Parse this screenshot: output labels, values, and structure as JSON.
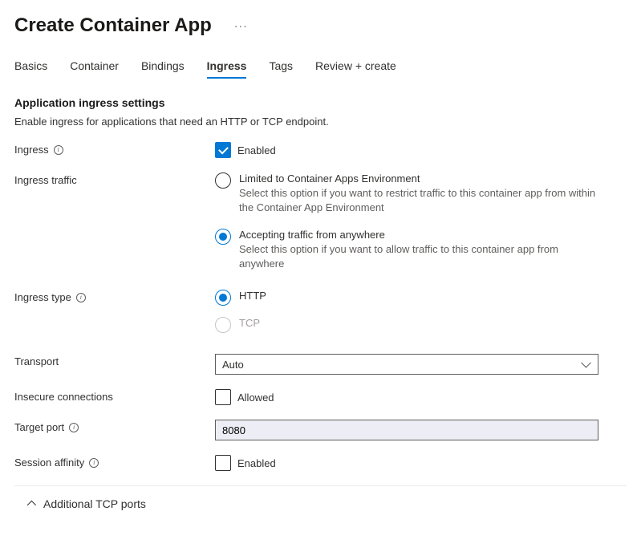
{
  "header": {
    "title": "Create Container App",
    "ellipsis": "···"
  },
  "tabs": [
    {
      "label": "Basics",
      "active": false
    },
    {
      "label": "Container",
      "active": false
    },
    {
      "label": "Bindings",
      "active": false
    },
    {
      "label": "Ingress",
      "active": true
    },
    {
      "label": "Tags",
      "active": false
    },
    {
      "label": "Review + create",
      "active": false
    }
  ],
  "section": {
    "title": "Application ingress settings",
    "desc": "Enable ingress for applications that need an HTTP or TCP endpoint."
  },
  "fields": {
    "ingress": {
      "label": "Ingress",
      "value_label": "Enabled",
      "checked": true
    },
    "traffic": {
      "label": "Ingress traffic",
      "options": [
        {
          "label": "Limited to Container Apps Environment",
          "desc": "Select this option if you want to restrict traffic to this container app from within the Container App Environment",
          "checked": false
        },
        {
          "label": "Accepting traffic from anywhere",
          "desc": "Select this option if you want to allow traffic to this container app from anywhere",
          "checked": true
        }
      ]
    },
    "type": {
      "label": "Ingress type",
      "options": [
        {
          "label": "HTTP",
          "checked": true,
          "disabled": false
        },
        {
          "label": "TCP",
          "checked": false,
          "disabled": true
        }
      ]
    },
    "transport": {
      "label": "Transport",
      "selected": "Auto"
    },
    "insecure": {
      "label": "Insecure connections",
      "value_label": "Allowed",
      "checked": false
    },
    "port": {
      "label": "Target port",
      "value": "8080"
    },
    "affinity": {
      "label": "Session affinity",
      "value_label": "Enabled",
      "checked": false
    }
  },
  "accordion": {
    "label": "Additional TCP ports"
  }
}
